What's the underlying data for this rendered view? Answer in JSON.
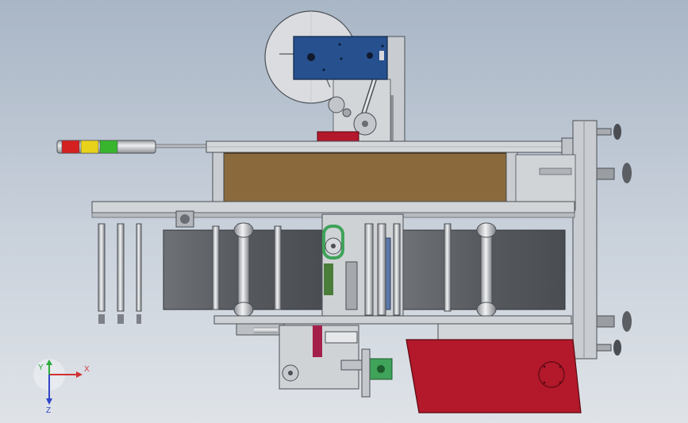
{
  "viewport": {
    "background_top": "#a9b6c6",
    "background_bottom": "#dfe3e8"
  },
  "model": {
    "frame_color": "#c9ccd0",
    "frame_edge": "#4a4f55",
    "brown_panel": "#8a6a3c",
    "red_base": "#b3182b",
    "blue_motor": "#27508f",
    "belt_gray": "#5e6166",
    "green_part": "#3fa35a",
    "signal_tower_colors": [
      "#d42020",
      "#e8d21a",
      "#38b52c"
    ]
  },
  "triad": {
    "x_label": "X",
    "y_label": "Y",
    "z_label": "Z",
    "x_color": "#d03030",
    "y_color": "#2eaa3a",
    "z_color": "#2f45c8"
  }
}
